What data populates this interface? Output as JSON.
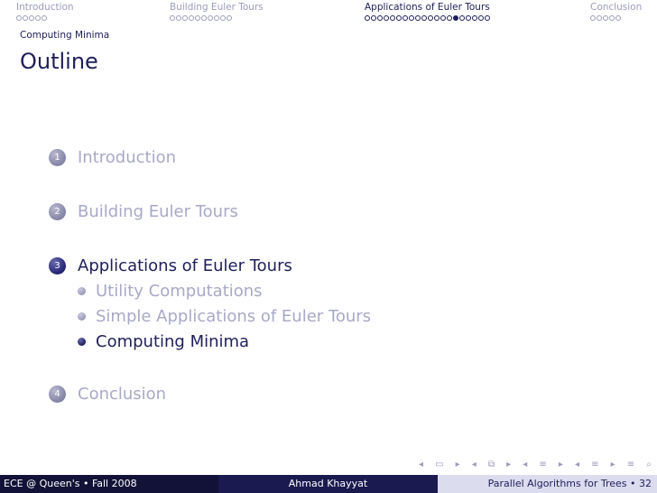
{
  "nav": {
    "sections": [
      {
        "title": "Introduction",
        "dots_total": 5,
        "dots_filled": [],
        "active": false
      },
      {
        "title": "Building Euler Tours",
        "dots_total": 10,
        "dots_filled": [],
        "active": false
      },
      {
        "title": "Applications of Euler Tours",
        "dots_total": 20,
        "dots_filled": [
          14
        ],
        "active": true
      },
      {
        "title": "Conclusion",
        "dots_total": 5,
        "dots_filled": [],
        "active": false
      }
    ],
    "subsection": "Computing Minima"
  },
  "frame": {
    "title": "Outline"
  },
  "outline": {
    "items": [
      {
        "number": "1",
        "label": "Introduction",
        "active": false
      },
      {
        "number": "2",
        "label": "Building Euler Tours",
        "active": false
      },
      {
        "number": "3",
        "label": "Applications of Euler Tours",
        "active": true
      },
      {
        "number": "4",
        "label": "Conclusion",
        "active": false
      }
    ],
    "subitems": [
      {
        "label": "Utility Computations",
        "active": false
      },
      {
        "label": "Simple Applications of Euler Tours",
        "active": false
      },
      {
        "label": "Computing Minima",
        "active": true
      }
    ]
  },
  "navsymbols": [
    "slide-prev-icon",
    "slide-next-icon",
    "frame-prev-icon",
    "frame-next-icon",
    "subsection-prev-icon",
    "subsection-next-icon",
    "section-prev-icon",
    "section-next-icon",
    "align-icon",
    "search-icon"
  ],
  "footer": {
    "left": "ECE @ Queen's • Fall 2008",
    "center": "Ahmad Khayyat",
    "right": "Parallel Algorithms for Trees • 32"
  },
  "colors": {
    "structure": "#1e1e5a",
    "faded": "#a8a8c8",
    "footer_dark": "#121238",
    "footer_mid": "#1a1a50",
    "footer_light": "#dcdcef"
  }
}
